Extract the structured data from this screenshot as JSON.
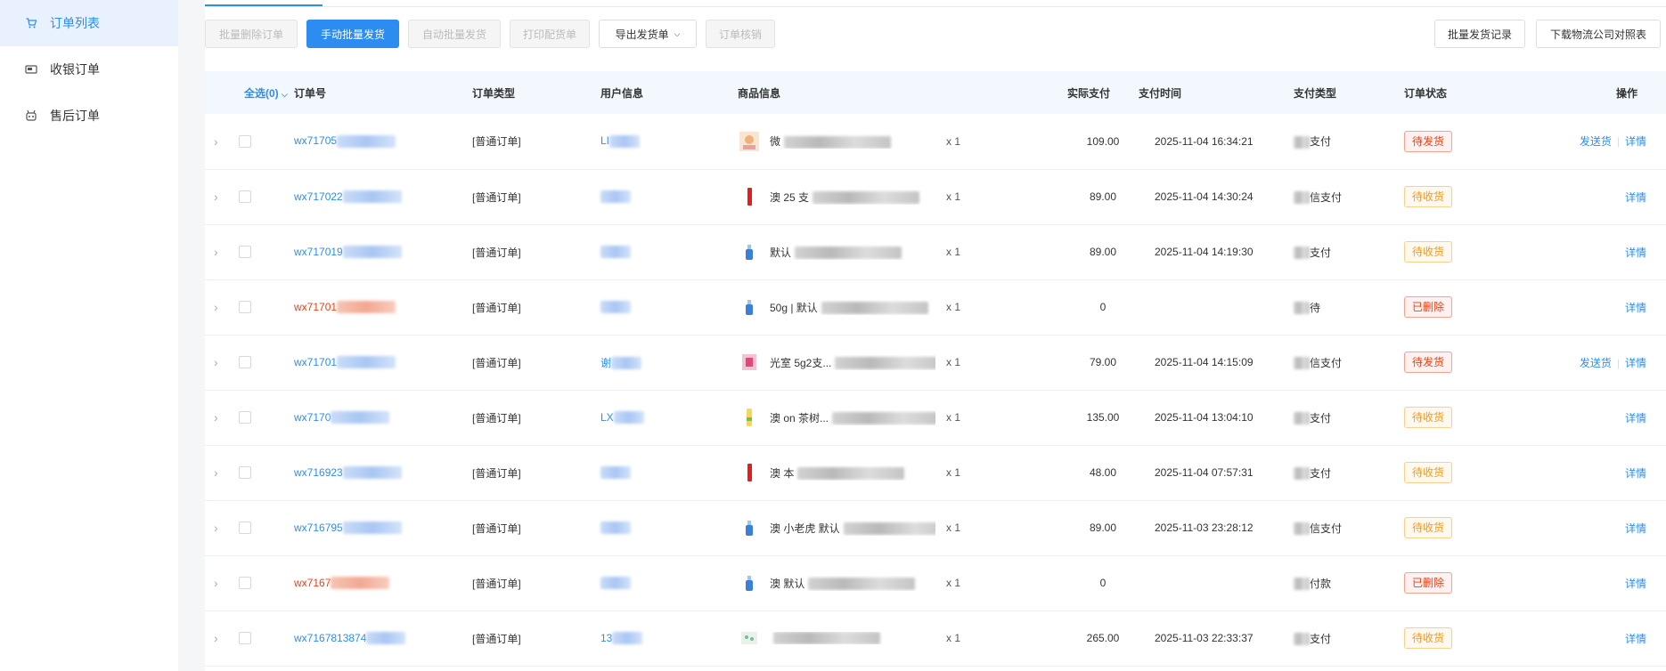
{
  "sidebar": {
    "items": [
      {
        "label": "订单列表",
        "icon": "cart-icon",
        "active": true
      },
      {
        "label": "收银订单",
        "icon": "cashier-icon",
        "active": false
      },
      {
        "label": "售后订单",
        "icon": "aftersale-icon",
        "active": false
      }
    ]
  },
  "toolbar": {
    "batch_delete": "批量删除订单",
    "manual_ship": "手动批量发货",
    "auto_ship": "自动批量发货",
    "print": "打印配货单",
    "export": "导出发货单",
    "verify": "订单核销",
    "ship_records": "批量发货记录",
    "download_logistics": "下载物流公司对照表"
  },
  "table": {
    "headers": {
      "select_all": "全选(0)",
      "order_no": "订单号",
      "order_type": "订单类型",
      "user_info": "用户信息",
      "goods_info": "商品信息",
      "paid": "实际支付",
      "pay_time": "支付时间",
      "pay_type": "支付类型",
      "status": "订单状态",
      "ops": "操作"
    },
    "rows": [
      {
        "order_prefix": "wx71705",
        "deleted": false,
        "type": "[普通订单]",
        "user": "LI",
        "goods": "微",
        "qty": "x 1",
        "paid": "109.00",
        "time": "2025-11-04 16:34:21",
        "pay_type": "支付",
        "status": "待发货",
        "status_kind": "ship",
        "ops": [
          "发送货",
          "详情"
        ]
      },
      {
        "order_prefix": "wx717022",
        "deleted": false,
        "type": "[普通订单]",
        "user": "",
        "goods": "澳 25 支",
        "qty": "x 1",
        "paid": "89.00",
        "time": "2025-11-04 14:30:24",
        "pay_type": "信支付",
        "status": "待收货",
        "status_kind": "recv",
        "ops": [
          "详情"
        ]
      },
      {
        "order_prefix": "wx717019",
        "deleted": false,
        "type": "[普通订单]",
        "user": "",
        "goods": "默认",
        "qty": "x 1",
        "paid": "89.00",
        "time": "2025-11-04 14:19:30",
        "pay_type": "支付",
        "status": "待收货",
        "status_kind": "recv",
        "ops": [
          "详情"
        ]
      },
      {
        "order_prefix": "wx71701",
        "deleted": true,
        "type": "[普通订单]",
        "user": "",
        "goods": "50g | 默认",
        "qty": "x 1",
        "paid": "0",
        "time": "",
        "pay_type": "待",
        "status": "已删除",
        "status_kind": "del",
        "ops": [
          "详情"
        ]
      },
      {
        "order_prefix": "wx71701",
        "deleted": false,
        "type": "[普通订单]",
        "user": "谢",
        "goods": "光室 5g2支...",
        "qty": "x 1",
        "paid": "79.00",
        "time": "2025-11-04 14:15:09",
        "pay_type": "信支付",
        "status": "待发货",
        "status_kind": "ship",
        "ops": [
          "发送货",
          "详情"
        ]
      },
      {
        "order_prefix": "wx7170",
        "deleted": false,
        "type": "[普通订单]",
        "user": "LX",
        "goods": "澳 on 茶树...",
        "qty": "x 1",
        "paid": "135.00",
        "time": "2025-11-04 13:04:10",
        "pay_type": "支付",
        "status": "待收货",
        "status_kind": "recv",
        "ops": [
          "详情"
        ]
      },
      {
        "order_prefix": "wx716923",
        "deleted": false,
        "type": "[普通订单]",
        "user": "",
        "goods": "澳 本",
        "qty": "x 1",
        "paid": "48.00",
        "time": "2025-11-04 07:57:31",
        "pay_type": "支付",
        "status": "待收货",
        "status_kind": "recv",
        "ops": [
          "详情"
        ]
      },
      {
        "order_prefix": "wx716795",
        "deleted": false,
        "type": "[普通订单]",
        "user": "",
        "goods": "澳 小老虎 默认",
        "qty": "x 1",
        "paid": "89.00",
        "time": "2025-11-03 23:28:12",
        "pay_type": "信支付",
        "status": "待收货",
        "status_kind": "recv",
        "ops": [
          "详情"
        ]
      },
      {
        "order_prefix": "wx7167",
        "deleted": true,
        "type": "[普通订单]",
        "user": "",
        "goods": "澳 默认",
        "qty": "x 1",
        "paid": "0",
        "time": "",
        "pay_type": "付款",
        "status": "已删除",
        "status_kind": "del",
        "ops": [
          "详情"
        ]
      },
      {
        "order_prefix": "wx7167813874",
        "deleted": false,
        "type": "[普通订单]",
        "user": "13",
        "goods": "",
        "qty": "x 1",
        "paid": "265.00",
        "time": "2025-11-03 22:33:37",
        "pay_type": "支付",
        "status": "待收货",
        "status_kind": "recv",
        "ops": [
          "详情"
        ]
      }
    ]
  },
  "colors": {
    "accent": "#2d8cf0",
    "danger": "#ed4014",
    "warning": "#f59a23"
  }
}
